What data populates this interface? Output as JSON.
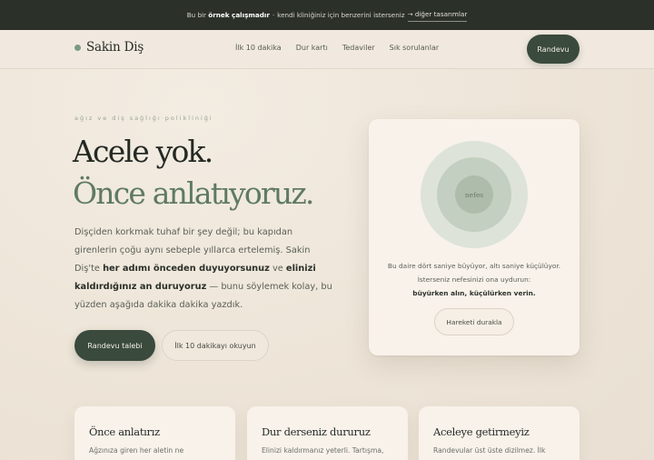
{
  "topbar": {
    "prefix": "Bu bir",
    "bold": "örnek çalışmadır",
    "separator": "·",
    "middle": "kendi kliniğiniz için benzerini isterseniz",
    "link": "→ diğer tasarımlar"
  },
  "nav": {
    "logo": "Sakin Diş",
    "links": [
      "İlk 10 dakika",
      "Dur kartı",
      "Tedaviler",
      "Sık sorulanlar"
    ],
    "cta": "Randevu"
  },
  "hero": {
    "eyebrow": "ağız ve diş sağlığı polikliniği",
    "title_line1": "Acele yok.",
    "title_line2": "Önce anlatıyoruz.",
    "lede_part1": "Dişçiden korkmak tuhaf bir şey değil; bu kapıdan girenlerin çoğu aynı sebeple yıllarca ertelemiş. Sakin Diş'te",
    "lede_bold1": "her adımı önceden duyuyorsunuz",
    "lede_part2": "ve",
    "lede_bold2": "elinizi kaldırdığınız an duruyoruz",
    "lede_part3": "— bunu söylemek kolay, bu yüzden aşağıda dakika dakika yazdık.",
    "primary_button": "Randevu talebi",
    "secondary_button": "İlk 10 dakikayı okuyun"
  },
  "breath_card": {
    "center_label": "nefes",
    "text_part1": "Bu daire dört saniye büyüyor, altı saniye küçülüyor. İsterseniz nefesinizi ona uydurun:",
    "text_bold": "büyürken alın, küçülürken verin.",
    "button": "Hareketi durakla"
  },
  "features": [
    {
      "title": "Önce anlatırız",
      "text": "Ağzınıza giren her aletin ne"
    },
    {
      "title": "Dur derseniz dururuz",
      "text": "Elinizi kaldırmanız yeterli. Tartışma,"
    },
    {
      "title": "Aceleye getirmeyiz",
      "text": "Randevular üst üste dizilmez. İlk"
    }
  ]
}
